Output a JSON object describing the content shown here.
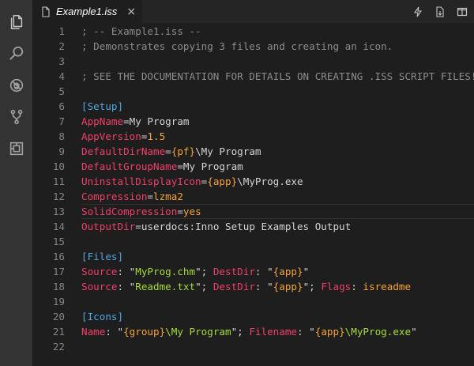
{
  "activity_bar": {
    "items": [
      {
        "icon": "files-icon"
      },
      {
        "icon": "search-icon"
      },
      {
        "icon": "debug-icon"
      },
      {
        "icon": "source-control-icon"
      },
      {
        "icon": "extensions-icon"
      }
    ]
  },
  "tab": {
    "title": "Example1.iss",
    "close": "×"
  },
  "tab_actions": [
    {
      "icon": "lightning-icon"
    },
    {
      "icon": "open-preview-icon"
    },
    {
      "icon": "split-editor-icon"
    }
  ],
  "colors": {
    "comment": "#8c8c8c",
    "section": "#4fa6e0",
    "key": "#f0406a",
    "string": "#a6db3c",
    "constant": "#f6a33a"
  },
  "editor": {
    "current_line": 13,
    "lines": [
      {
        "n": "1",
        "tokens": [
          {
            "t": "comment",
            "v": "; -- Example1.iss --"
          }
        ]
      },
      {
        "n": "2",
        "tokens": [
          {
            "t": "comment",
            "v": "; Demonstrates copying 3 files and creating an icon."
          }
        ]
      },
      {
        "n": "3",
        "tokens": []
      },
      {
        "n": "4",
        "tokens": [
          {
            "t": "comment",
            "v": "; SEE THE DOCUMENTATION FOR DETAILS ON CREATING .ISS SCRIPT FILES!"
          }
        ]
      },
      {
        "n": "5",
        "tokens": []
      },
      {
        "n": "6",
        "tokens": [
          {
            "t": "section",
            "v": "[Setup]"
          }
        ]
      },
      {
        "n": "7",
        "tokens": [
          {
            "t": "key",
            "v": "AppName"
          },
          {
            "t": "eq",
            "v": "="
          },
          {
            "t": "plain",
            "v": "My Program"
          }
        ]
      },
      {
        "n": "8",
        "tokens": [
          {
            "t": "key",
            "v": "AppVersion"
          },
          {
            "t": "eq",
            "v": "="
          },
          {
            "t": "num",
            "v": "1.5"
          }
        ]
      },
      {
        "n": "9",
        "tokens": [
          {
            "t": "key",
            "v": "DefaultDirName"
          },
          {
            "t": "eq",
            "v": "="
          },
          {
            "t": "var",
            "v": "{pf}"
          },
          {
            "t": "plain",
            "v": "\\My Program"
          }
        ]
      },
      {
        "n": "10",
        "tokens": [
          {
            "t": "key",
            "v": "DefaultGroupName"
          },
          {
            "t": "eq",
            "v": "="
          },
          {
            "t": "plain",
            "v": "My Program"
          }
        ]
      },
      {
        "n": "11",
        "tokens": [
          {
            "t": "key",
            "v": "UninstallDisplayIcon"
          },
          {
            "t": "eq",
            "v": "="
          },
          {
            "t": "var",
            "v": "{app}"
          },
          {
            "t": "plain",
            "v": "\\MyProg.exe"
          }
        ]
      },
      {
        "n": "12",
        "tokens": [
          {
            "t": "key",
            "v": "Compression"
          },
          {
            "t": "eq",
            "v": "="
          },
          {
            "t": "const",
            "v": "lzma2"
          }
        ]
      },
      {
        "n": "13",
        "tokens": [
          {
            "t": "key",
            "v": "SolidCompression"
          },
          {
            "t": "eq",
            "v": "="
          },
          {
            "t": "const",
            "v": "yes"
          }
        ]
      },
      {
        "n": "14",
        "tokens": [
          {
            "t": "key",
            "v": "OutputDir"
          },
          {
            "t": "eq",
            "v": "="
          },
          {
            "t": "plain",
            "v": "userdocs:Inno Setup Examples Output"
          }
        ]
      },
      {
        "n": "15",
        "tokens": []
      },
      {
        "n": "16",
        "tokens": [
          {
            "t": "section",
            "v": "[Files]"
          }
        ]
      },
      {
        "n": "17",
        "tokens": [
          {
            "t": "key",
            "v": "Source"
          },
          {
            "t": "plain",
            "v": ": \""
          },
          {
            "t": "str",
            "v": "MyProg.chm"
          },
          {
            "t": "plain",
            "v": "\"; "
          },
          {
            "t": "key",
            "v": "DestDir"
          },
          {
            "t": "plain",
            "v": ": \""
          },
          {
            "t": "var",
            "v": "{app}"
          },
          {
            "t": "plain",
            "v": "\""
          }
        ]
      },
      {
        "n": "18",
        "tokens": [
          {
            "t": "key",
            "v": "Source"
          },
          {
            "t": "plain",
            "v": ": \""
          },
          {
            "t": "str",
            "v": "Readme.txt"
          },
          {
            "t": "plain",
            "v": "\"; "
          },
          {
            "t": "key",
            "v": "DestDir"
          },
          {
            "t": "plain",
            "v": ": \""
          },
          {
            "t": "var",
            "v": "{app}"
          },
          {
            "t": "plain",
            "v": "\"; "
          },
          {
            "t": "key",
            "v": "Flags"
          },
          {
            "t": "plain",
            "v": ": "
          },
          {
            "t": "const",
            "v": "isreadme"
          }
        ]
      },
      {
        "n": "19",
        "tokens": []
      },
      {
        "n": "20",
        "tokens": [
          {
            "t": "section",
            "v": "[Icons]"
          }
        ]
      },
      {
        "n": "21",
        "tokens": [
          {
            "t": "key",
            "v": "Name"
          },
          {
            "t": "plain",
            "v": ": \""
          },
          {
            "t": "var",
            "v": "{group}"
          },
          {
            "t": "str",
            "v": "\\My Program"
          },
          {
            "t": "plain",
            "v": "\"; "
          },
          {
            "t": "key",
            "v": "Filename"
          },
          {
            "t": "plain",
            "v": ": \""
          },
          {
            "t": "var",
            "v": "{app}"
          },
          {
            "t": "str",
            "v": "\\MyProg.exe"
          },
          {
            "t": "plain",
            "v": "\""
          }
        ]
      },
      {
        "n": "22",
        "tokens": []
      }
    ]
  }
}
